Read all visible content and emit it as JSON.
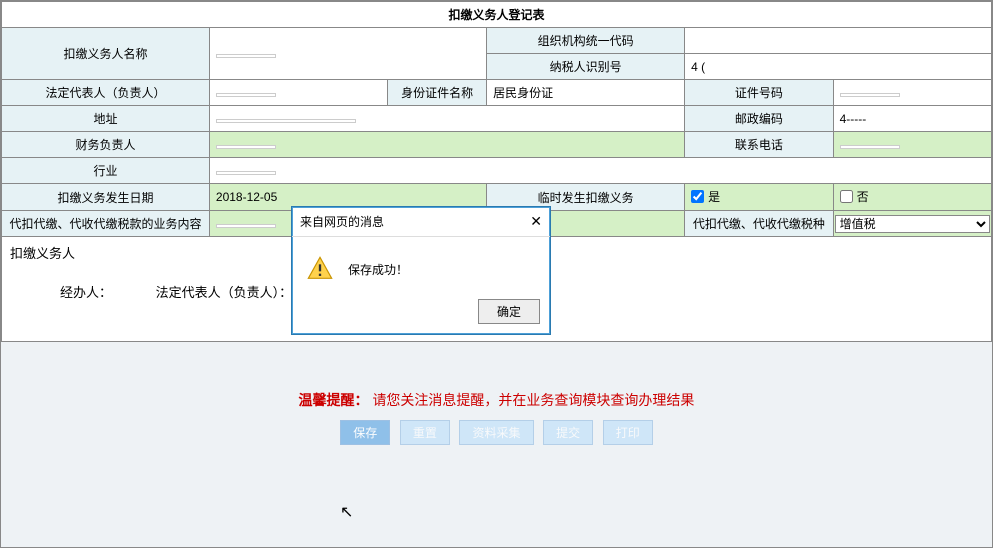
{
  "title": "扣缴义务人登记表",
  "fields": {
    "agent_name_label": "扣缴义务人名称",
    "agent_name_value": "",
    "org_code_label": "组织机构统一代码",
    "org_code_value": "",
    "taxpayer_id_label": "纳税人识别号",
    "taxpayer_id_value": "4                     (",
    "legal_rep_label": "法定代表人（负责人）",
    "legal_rep_value": "",
    "id_type_label": "身份证件名称",
    "id_type_value": "居民身份证",
    "id_no_label": "证件号码",
    "id_no_value": "",
    "address_label": "地址",
    "address_value": "",
    "postcode_label": "邮政编码",
    "postcode_value": "4-----",
    "finance_label": "财务负责人",
    "finance_value": "",
    "phone_label": "联系电话",
    "phone_value": "",
    "industry_label": "行业",
    "industry_value": "",
    "date_label": "扣缴义务发生日期",
    "date_value": "2018-12-05",
    "temp_label": "临时发生扣缴义务",
    "yes": "是",
    "no": "否",
    "biz_content_label": "代扣代缴、代收代缴税款的业务内容",
    "biz_content_value": "",
    "tax_type_label": "代扣代缴、代收代缴税种",
    "tax_type_value": "增值税"
  },
  "signature": {
    "section": "扣缴义务人",
    "handler": "经办人：",
    "legal": "法定代表人（负责人）："
  },
  "reminder": {
    "label": "温馨提醒：",
    "text": "请您关注消息提醒，并在业务查询模块查询办理结果"
  },
  "buttons": {
    "save": "保存",
    "reset": "重置",
    "collect": "资料采集",
    "submit": "提交",
    "print": "打印"
  },
  "modal": {
    "title": "来自网页的消息",
    "msg": "保存成功！",
    "ok": "确定"
  }
}
